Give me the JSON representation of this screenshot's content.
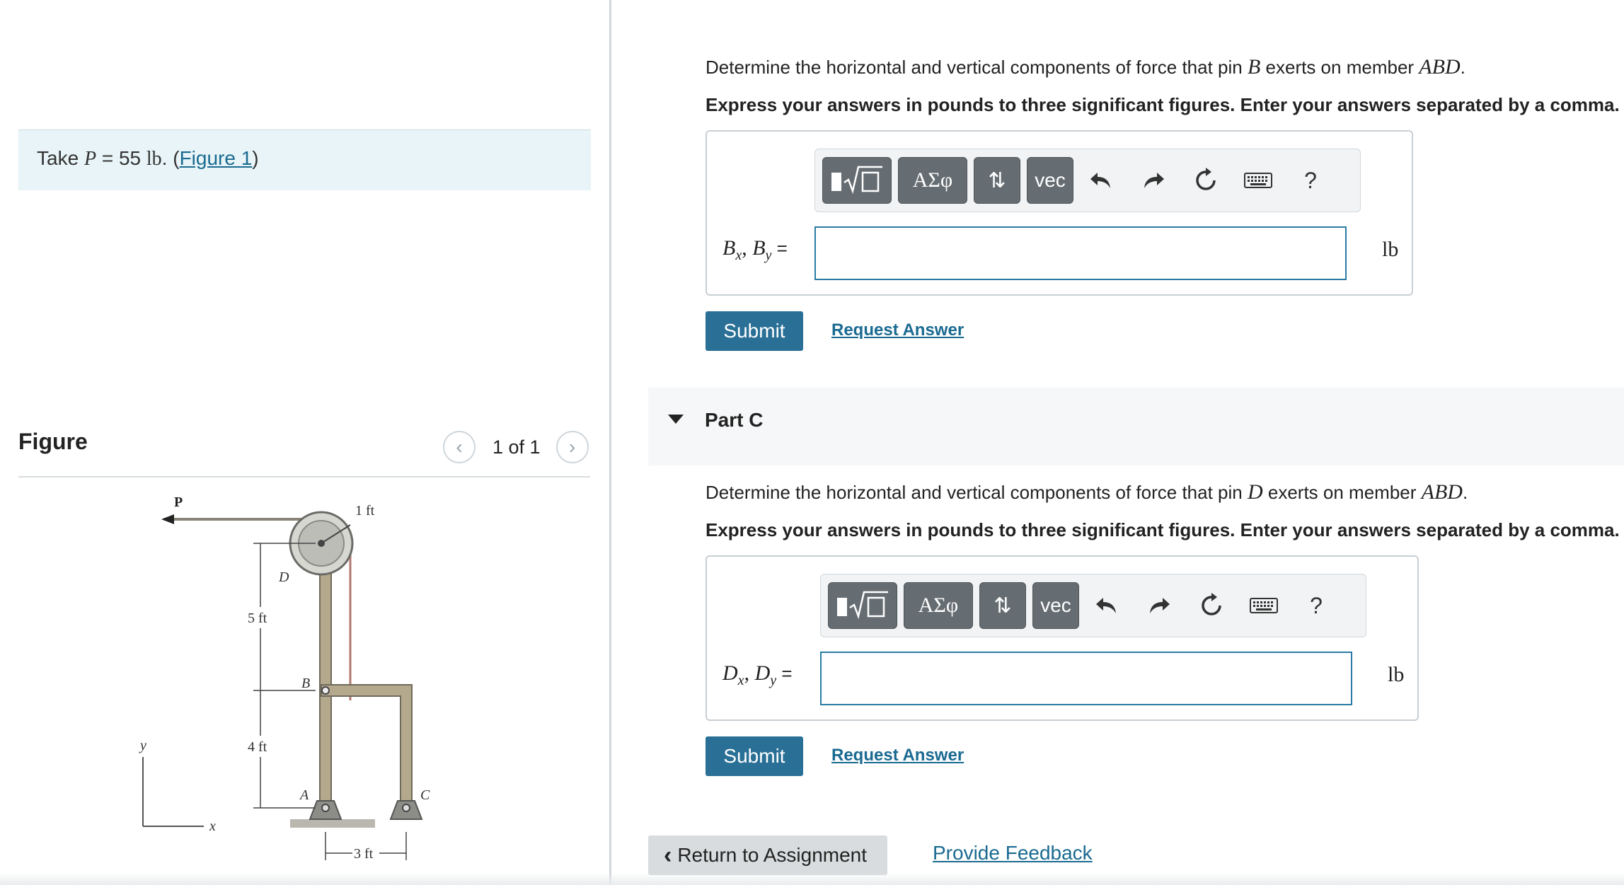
{
  "left": {
    "take": {
      "prefix": "Take ",
      "var": "P",
      "eq": " = 55 ",
      "unit": "lb",
      "dot": ". (",
      "link": "Figure 1",
      "close": ")"
    },
    "figure_title": "Figure",
    "pager": {
      "count": "1 of 1",
      "prev_icon": "chevron-left-icon",
      "next_icon": "chevron-right-icon"
    },
    "figure_labels": {
      "p": "P",
      "one_ft": "1 ft",
      "d": "D",
      "five_ft": "5 ft",
      "b": "B",
      "four_ft": "4 ft",
      "a": "A",
      "c": "C",
      "three_ft": "3 ft",
      "y": "y",
      "x": "x"
    }
  },
  "partB": {
    "question_pre": "Determine the horizontal and vertical components of force that pin ",
    "pin": "B",
    "question_mid": " exerts on member ",
    "member": "ABD",
    "question_end": ".",
    "instruction": "Express your answers in pounds to three significant figures. Enter your answers separated by a comma.",
    "label_var1": "B",
    "label_sub1": "x",
    "label_sep": ", ",
    "label_var2": "B",
    "label_sub2": "y",
    "label_eq": " =",
    "input_value": "",
    "unit": "lb",
    "submit": "Submit",
    "request": "Request Answer"
  },
  "partC": {
    "title": "Part C",
    "question_pre": "Determine the horizontal and vertical components of force that pin ",
    "pin": "D",
    "question_mid": " exerts on member ",
    "member": "ABD",
    "question_end": ".",
    "instruction": "Express your answers in pounds to three significant figures. Enter your answers separated by a comma.",
    "label_var1": "D",
    "label_sub1": "x",
    "label_sep": ", ",
    "label_var2": "D",
    "label_sub2": "y",
    "label_eq": " =",
    "input_value": "",
    "unit": "lb",
    "submit": "Submit",
    "request": "Request Answer"
  },
  "toolbar": {
    "templates_icon": "fraction-radical-template-icon",
    "greek": "ΑΣφ",
    "arrows": "⇅",
    "vec": "vec",
    "undo_icon": "undo-icon",
    "redo_icon": "redo-icon",
    "reset_icon": "reset-icon",
    "keyboard_icon": "keyboard-icon",
    "help": "?"
  },
  "footer": {
    "return": "Return to Assignment",
    "feedback": "Provide Feedback"
  }
}
